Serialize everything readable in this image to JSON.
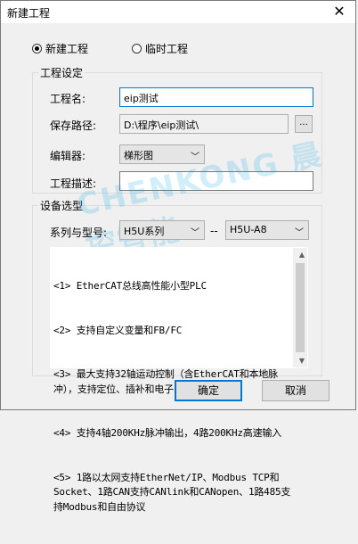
{
  "window": {
    "title": "新建工程",
    "close_glyph": "✕"
  },
  "project_type": {
    "option_new": "新建工程",
    "option_temp": "临时工程",
    "selected": "新建工程"
  },
  "project_settings": {
    "legend": "工程设定",
    "name_label": "工程名:",
    "name_value": "eip测试",
    "path_label": "保存路径:",
    "path_value": "D:\\程序\\eip测试\\",
    "browse_label": "...",
    "editor_label": "编辑器:",
    "editor_value": "梯形图",
    "desc_label": "工程描述:",
    "desc_value": ""
  },
  "device": {
    "legend": "设备选型",
    "series_label": "系列与型号:",
    "series_value": "H5U系列",
    "separator": "--",
    "model_value": "H5U-A8",
    "description_lines": [
      "<1> EtherCAT总线高性能小型PLC",
      "<2> 支持自定义变量和FB/FC",
      "<3> 最大支持32轴运动控制（含EtherCAT和本地脉冲），支持定位、插补和电子凸轮",
      "<4> 支持4轴200KHz脉冲输出，4路200KHz高速输入",
      "<5> 1路以太网支持EtherNet/IP、Modbus TCP和Socket、1路CAN支持CANlink和CANopen、1路485支持Modbus和自由协议"
    ]
  },
  "watermark": "CHENKONG 晨控智能",
  "buttons": {
    "ok": "确定",
    "cancel": "取消"
  },
  "colors": {
    "focus": "#0078d7",
    "watermark": "#00a8e6"
  }
}
